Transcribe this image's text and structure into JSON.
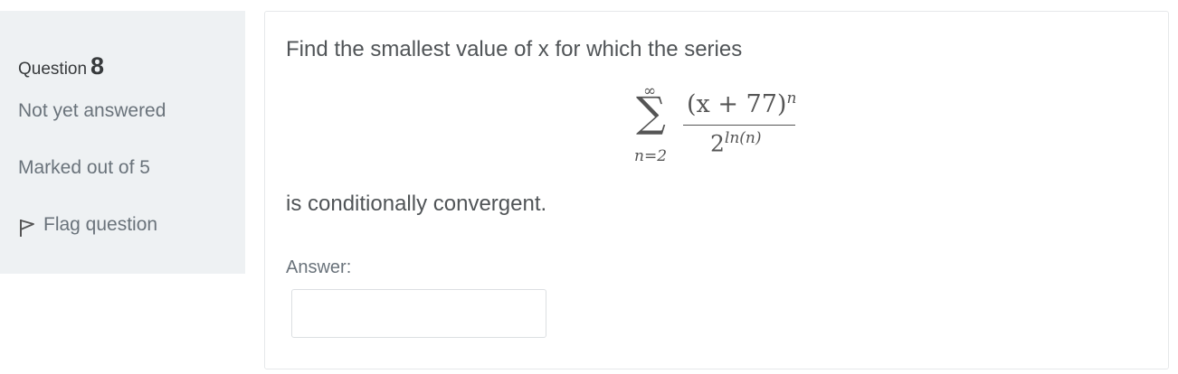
{
  "info": {
    "question_label": "Question",
    "question_number": "8",
    "state": "Not yet answered",
    "grade": "Marked out of 5",
    "flag_label": "Flag question"
  },
  "question": {
    "text_before": "Find the smallest value of x for which the series",
    "formula": {
      "sum_upper": "∞",
      "sum_symbol": "∑",
      "sum_lower": "n=2",
      "numerator": "(x + 77)",
      "numerator_exponent": "n",
      "denominator_base": "2",
      "denominator_exponent": "ln(n)"
    },
    "text_after": "is conditionally convergent."
  },
  "answer": {
    "label": "Answer:",
    "value": "",
    "placeholder": ""
  }
}
